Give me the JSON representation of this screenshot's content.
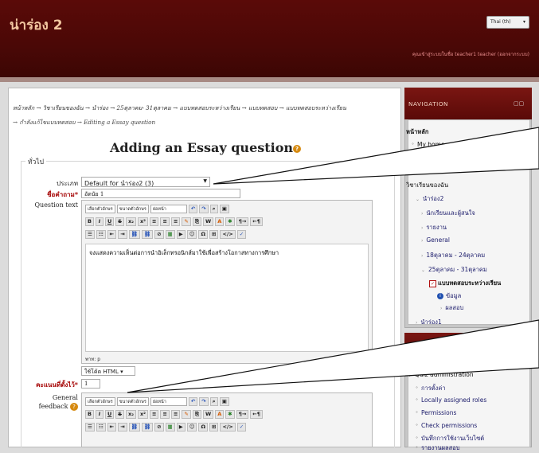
{
  "header": {
    "site_title": "น่าร่อง 2",
    "language": "Thai (th)",
    "login_info": "คุณเข้าสู่ระบบในชื่อ teacher1 teacher (ออกจากระบบ)"
  },
  "breadcrumb": {
    "line1": "หน้าหลัก → วิชาเรียนของฉัน → นำร่อง → 25ตุลาคม- 31ตุลาคม → แบบทดสอบระหว่างเรียน → แบบทดสอบ → แบบทดสอบระหว่างเรียน",
    "line2": "→ กำลังแก้ไขแบบทดสอบ → Editing a Essay question"
  },
  "page_heading": "Adding an Essay question",
  "form": {
    "legend": "ทั่วไป",
    "category_label": "ประเภท",
    "category_value": "Default for นำร่อง2 (3)",
    "question_name_label": "ชื่อคำถาม*",
    "question_name_value": "อัตนัย 1",
    "question_text_label": "Question text",
    "toolbar": {
      "font_family": "เลือกตัวอักษร",
      "font_size": "ขนาดตัวอักษร",
      "paragraph": "ย่อหน้า"
    },
    "question_text_value": "จงแสดงความเห็นต่อการนำอิเล็กทรอนิกส์มาใช้เพื่อสร้างโอกาสทางการศึกษา",
    "path_label": "พาท: p",
    "format_value": "ใช้โค้ด HTML",
    "default_mark_label": "คะแนนที่ตั้งไว้*",
    "default_mark_value": "1",
    "general_feedback_label_1": "General",
    "general_feedback_label_2": "feedback"
  },
  "navigation": {
    "title": "NAVIGATION",
    "items": [
      {
        "label": "หน้าหลัก"
      },
      {
        "label": "My home"
      },
      {
        "label": "วิชาเรียนของฉัน"
      },
      {
        "label": "นำร่อง2"
      },
      {
        "label": "นักเรียนและผู้สนใจ"
      },
      {
        "label": "รายงาน"
      },
      {
        "label": "General"
      },
      {
        "label": "18ตุลาคม - 24ตุลาคม"
      },
      {
        "label": "25ตุลาคม - 31ตุลาคม"
      },
      {
        "label": "แบบทดสอบระหว่างเรียน"
      },
      {
        "label": "ข้อมูล"
      },
      {
        "label": "ผลสอบ"
      },
      {
        "label": "นำร่อง1"
      }
    ]
  },
  "admin": {
    "items": [
      {
        "label": "Quiz administration"
      },
      {
        "label": "การตั้งค่า"
      },
      {
        "label": "Locally assigned roles"
      },
      {
        "label": "Permissions"
      },
      {
        "label": "Check permissions"
      },
      {
        "label": "บันทึกการใช้งานเว็บไซต์"
      },
      {
        "label": "รายงานผลสอบ"
      }
    ]
  },
  "colors": {
    "header_bg": "#4a0806",
    "accent": "#a40000",
    "site_title": "#f2c7a0"
  }
}
